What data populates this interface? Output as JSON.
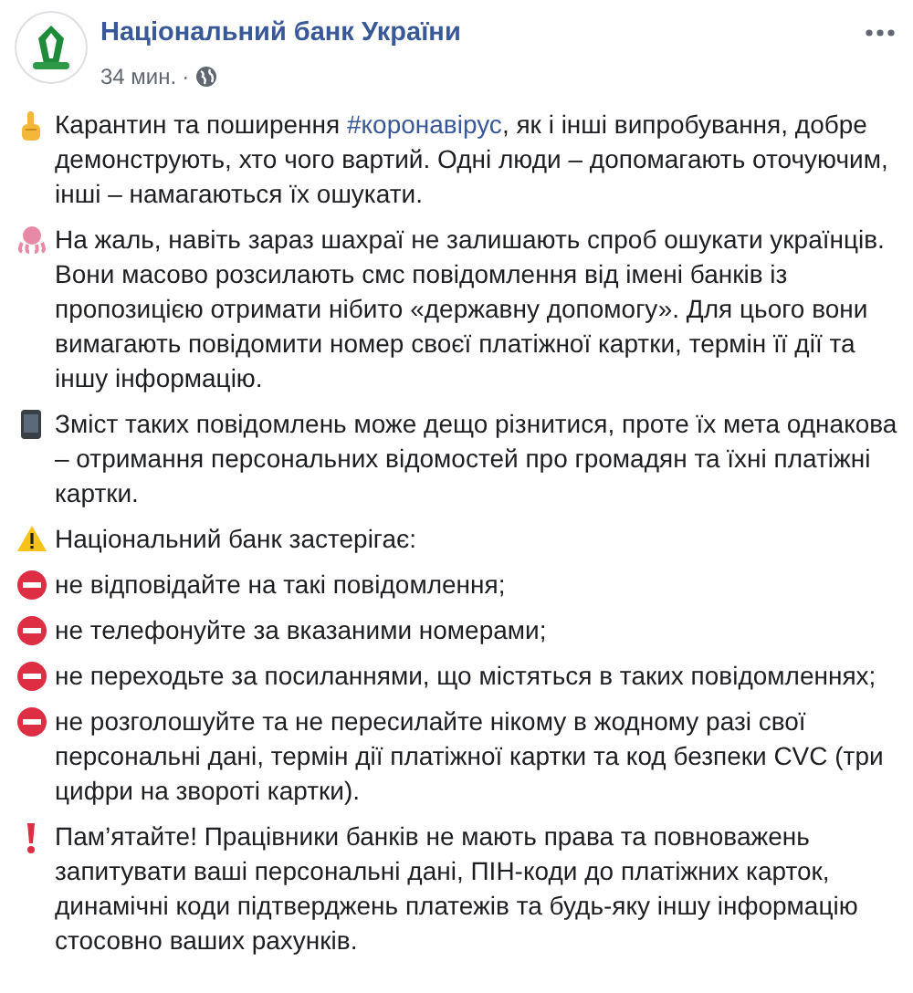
{
  "page": {
    "name": "Національний банк України",
    "time": "34 мин.",
    "separator": "·"
  },
  "paragraphs": [
    {
      "kind": "finger",
      "before": "Карантин та поширення ",
      "hashtag": "#коронавірус",
      "after": ", як і інші випробування, добре демонструють, хто чого вартий. Одні люди – допомагають оточуючим, інші – намагаються їх ошукати."
    },
    {
      "kind": "octopus",
      "text": "На жаль, навіть зараз шахраї не залишають спроб ошукати українців. Вони масово розсилають смс повідомлення від імені банків із пропозицією отримати нібито «державну допомогу». Для цього вони вимагають повідомити номер своєї платіжної картки, термін її дії та іншу інформацію."
    },
    {
      "kind": "phone",
      "text": "Зміст таких повідомлень може дещо різнитися, проте їх мета однакова – отримання персональних відомостей про громадян та їхні платіжні картки."
    },
    {
      "kind": "warning",
      "text": "Національний банк застерігає:"
    },
    {
      "kind": "no-entry",
      "text": "не відповідайте на такі повідомлення;"
    },
    {
      "kind": "no-entry",
      "text": "не телефонуйте за вказаними номерами;"
    },
    {
      "kind": "no-entry",
      "text": "не переходьте за посиланнями, що містяться в таких повідомленнях;"
    },
    {
      "kind": "no-entry",
      "text": "не розголошуйте та не пересилайте нікому в жодному разі свої персональні дані, термін дії платіжної картки та код безпеки CVC (три цифри на звороті картки)."
    },
    {
      "kind": "exclamation",
      "text": "Пам’ятайте! Працівники банків не мають права та повноважень запитувати ваші персональні дані, ПІН-коди до платіжних карток, динамічні коди підтверджень платежів та будь-яку іншу інформацію стосовно ваших рахунків."
    }
  ]
}
